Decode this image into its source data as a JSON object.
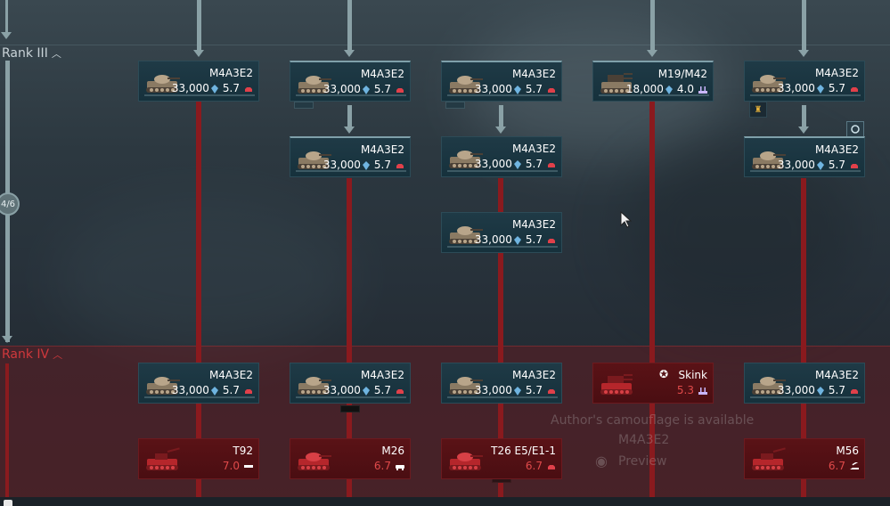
{
  "ranks": [
    {
      "label": "Rank III"
    },
    {
      "label": "Rank IV"
    }
  ],
  "progress": {
    "label": "4/6"
  },
  "cards": [
    {
      "name": "M4A3E2",
      "cost": "33,000",
      "br": "5.7",
      "type": "tank",
      "state": "researched"
    },
    {
      "name": "M4A3E2",
      "cost": "33,000",
      "br": "5.7",
      "type": "tank",
      "state": "researched"
    },
    {
      "name": "M4A3E2",
      "cost": "33,000",
      "br": "5.7",
      "type": "tank",
      "state": "researched"
    },
    {
      "name": "M19/M42",
      "cost": "18,000",
      "br": "4.0",
      "type": "spaa",
      "state": "researched"
    },
    {
      "name": "M4A3E2",
      "cost": "33,000",
      "br": "5.7",
      "type": "tank",
      "state": "researched"
    },
    {
      "name": "M4A3E2",
      "cost": "33,000",
      "br": "5.7",
      "type": "tank",
      "state": "researched"
    },
    {
      "name": "M4A3E2",
      "cost": "33,000",
      "br": "5.7",
      "type": "tank",
      "state": "researched"
    },
    {
      "name": "M4A3E2",
      "cost": "33,000",
      "br": "5.7",
      "type": "tank",
      "state": "researched"
    },
    {
      "name": "M4A3E2",
      "cost": "33,000",
      "br": "5.7",
      "type": "tank",
      "state": "researched"
    },
    {
      "name": "M4A3E2",
      "cost": "33,000",
      "br": "5.7",
      "type": "tank",
      "state": "researched"
    },
    {
      "name": "M4A3E2",
      "cost": "33,000",
      "br": "5.7",
      "type": "tank",
      "state": "researched"
    },
    {
      "name": "M4A3E2",
      "cost": "33,000",
      "br": "5.7",
      "type": "tank",
      "state": "researched"
    },
    {
      "name": "Skink",
      "cost": "",
      "br": "5.3",
      "type": "spaa",
      "state": "locked"
    },
    {
      "name": "M4A3E2",
      "cost": "33,000",
      "br": "5.7",
      "type": "tank",
      "state": "researched"
    },
    {
      "name": "T92",
      "cost": "",
      "br": "7.0",
      "type": "spg",
      "state": "locked"
    },
    {
      "name": "M26",
      "cost": "",
      "br": "6.7",
      "type": "heavy",
      "state": "locked"
    },
    {
      "name": "T26 E5/E1-1",
      "cost": "",
      "br": "6.7",
      "type": "tank",
      "state": "locked"
    },
    {
      "name": "M56",
      "cost": "",
      "br": "6.7",
      "type": "td",
      "state": "locked"
    }
  ],
  "tooltip_ghost": {
    "line1": "Author's camouflage is available",
    "line2": "M4A3E2",
    "line3": "Preview"
  },
  "colors": {
    "researched_card": "#1a3540",
    "locked_card": "#4e1014",
    "rank4_label": "#d0383c",
    "locked_br": "#e04a4a",
    "rp_icon": "#6fb4e0",
    "tank_icon_red": "#e0404a"
  }
}
